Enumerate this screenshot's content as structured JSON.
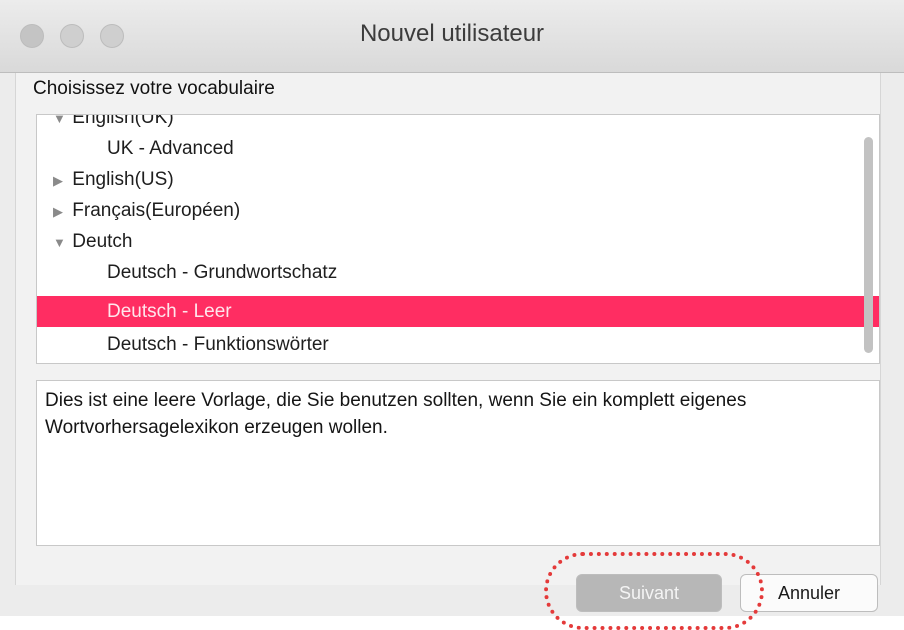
{
  "window": {
    "title": "Nouvel utilisateur"
  },
  "heading": "Choisissez votre vocabulaire",
  "list": {
    "items": [
      {
        "label": "English(UK)",
        "expander": "▼",
        "level": 0,
        "selected": false
      },
      {
        "label": "UK - Advanced",
        "expander": "",
        "level": 1,
        "selected": false
      },
      {
        "label": "English(US)",
        "expander": "▶",
        "level": 0,
        "selected": false
      },
      {
        "label": "Français(Européen)",
        "expander": "▶",
        "level": 0,
        "selected": false
      },
      {
        "label": "Deutch",
        "expander": "▼",
        "level": 0,
        "selected": false
      },
      {
        "label": "Deutsch - Grundwortschatz",
        "expander": "",
        "level": 1,
        "selected": false
      },
      {
        "label": "Deutsch - Leer",
        "expander": "",
        "level": 1,
        "selected": true
      },
      {
        "label": "Deutsch - Funktionswörter",
        "expander": "",
        "level": 1,
        "selected": false
      }
    ]
  },
  "description": "Dies ist eine leere Vorlage, die Sie benutzen sollten, wenn Sie ein komplett eigenes Wortvorhersagelexikon erzeugen wollen.",
  "buttons": {
    "next": "Suivant",
    "cancel": "Annuler"
  },
  "colors": {
    "selection": "#ff2d62",
    "annotation": "#e43a3a"
  }
}
